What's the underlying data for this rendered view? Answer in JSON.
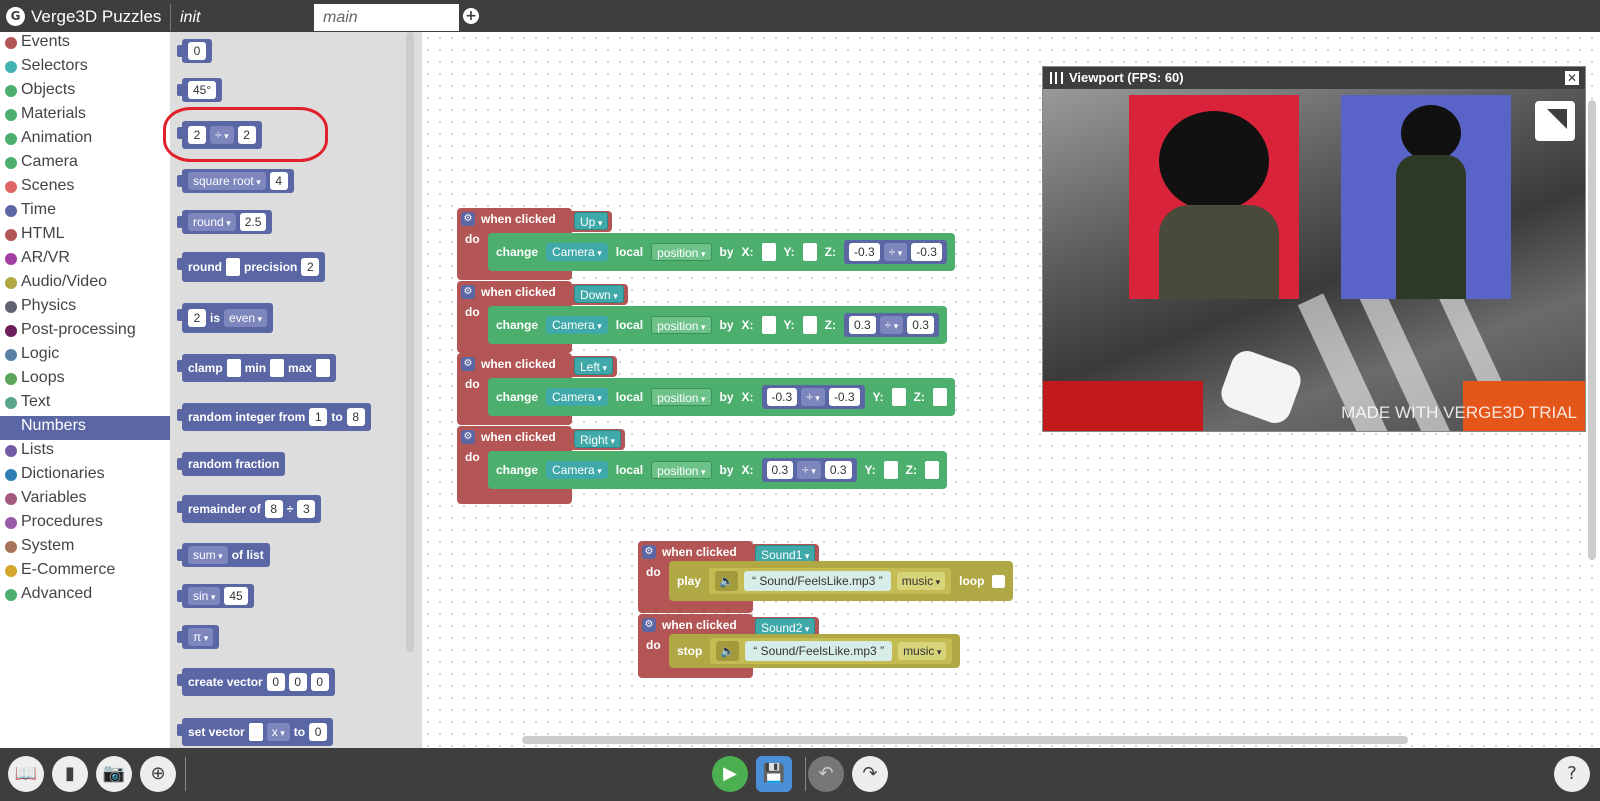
{
  "app": {
    "logo_glyph": "G",
    "title": "Verge3D Puzzles"
  },
  "tabs": {
    "init": "init",
    "main": "main",
    "add_glyph": "+"
  },
  "categories": [
    {
      "label": "Events",
      "color": "#b35555"
    },
    {
      "label": "Selectors",
      "color": "#45b3b3"
    },
    {
      "label": "Objects",
      "color": "#4caf6e"
    },
    {
      "label": "Materials",
      "color": "#4caf6e"
    },
    {
      "label": "Animation",
      "color": "#4caf6e"
    },
    {
      "label": "Camera",
      "color": "#4caf6e"
    },
    {
      "label": "Scenes",
      "color": "#e06666"
    },
    {
      "label": "Time",
      "color": "#5b67a5"
    },
    {
      "label": "HTML",
      "color": "#b35555"
    },
    {
      "label": "AR/VR",
      "color": "#a33fa3"
    },
    {
      "label": "Audio/Video",
      "color": "#b0a845"
    },
    {
      "label": "Physics",
      "color": "#5f6470"
    },
    {
      "label": "Post-processing",
      "color": "#6b1e5b"
    },
    {
      "label": "Logic",
      "color": "#5b80a5"
    },
    {
      "label": "Loops",
      "color": "#5ba55b"
    },
    {
      "label": "Text",
      "color": "#5ba58c"
    },
    {
      "label": "Numbers",
      "color": "#5b67a5"
    },
    {
      "label": "Lists",
      "color": "#745ba5"
    },
    {
      "label": "Dictionaries",
      "color": "#2f7fb5"
    },
    {
      "label": "Variables",
      "color": "#a55b80"
    },
    {
      "label": "Procedures",
      "color": "#995ba5"
    },
    {
      "label": "System",
      "color": "#a5745b"
    },
    {
      "label": "E-Commerce",
      "color": "#d4a72c"
    },
    {
      "label": "Advanced",
      "color": "#4caf6e"
    }
  ],
  "flyout": {
    "num0": "0",
    "angle": "45°",
    "arith": {
      "a": "2",
      "op": "÷",
      "b": "2"
    },
    "sqrt": {
      "fn": "square root",
      "val": "4"
    },
    "round1": {
      "fn": "round",
      "val": "2.5"
    },
    "round2": {
      "label": "round",
      "precision": "precision",
      "val": "2"
    },
    "even": {
      "val": "2",
      "is": "is",
      "prop": "even"
    },
    "clamp": {
      "label": "clamp",
      "min": "min",
      "max": "max"
    },
    "randint": {
      "label": "random integer from",
      "from": "1",
      "to": "to",
      "to_val": "8"
    },
    "randfrac": "random fraction",
    "remainder": {
      "label": "remainder of",
      "a": "8",
      "op": "÷",
      "b": "3"
    },
    "sum": {
      "fn": "sum",
      "label": "of list"
    },
    "sin": {
      "fn": "sin",
      "val": "45"
    },
    "pi": "π",
    "vector": {
      "label": "create vector",
      "x": "0",
      "y": "0",
      "z": "0"
    },
    "setvec": {
      "label": "set vector",
      "axis": "x",
      "to": "to",
      "val": "0"
    }
  },
  "events": [
    {
      "head": "when clicked",
      "target": "Up",
      "do": "do",
      "change": "change",
      "camera": "Camera",
      "local": "local",
      "position": "position",
      "by": "by",
      "x_label": "X:",
      "y_label": "Y:",
      "z_label": "Z:",
      "a": "-0.3",
      "op": "÷",
      "b": "-0.3"
    },
    {
      "head": "when clicked",
      "target": "Down",
      "do": "do",
      "change": "change",
      "camera": "Camera",
      "local": "local",
      "position": "position",
      "by": "by",
      "x_label": "X:",
      "y_label": "Y:",
      "z_label": "Z:",
      "a": "0.3",
      "op": "÷",
      "b": "0.3"
    },
    {
      "head": "when clicked",
      "target": "Left",
      "do": "do",
      "change": "change",
      "camera": "Camera",
      "local": "local",
      "position": "position",
      "by": "by",
      "x_label": "X:",
      "y_label": "Y:",
      "z_label": "Z:",
      "a": "-0.3",
      "op": "÷",
      "b": "-0.3"
    },
    {
      "head": "when clicked",
      "target": "Right",
      "do": "do",
      "change": "change",
      "camera": "Camera",
      "local": "local",
      "position": "position",
      "by": "by",
      "x_label": "X:",
      "y_label": "Y:",
      "z_label": "Z:",
      "a": "0.3",
      "op": "÷",
      "b": "0.3"
    }
  ],
  "sound_events": [
    {
      "head": "when clicked",
      "target": "Sound1",
      "do": "do",
      "action": "play",
      "file": "Sound/FeelsLike.mp3",
      "type": "music",
      "loop": "loop",
      "quote_open": "“",
      "quote_close": "”",
      "speaker": "🔈"
    },
    {
      "head": "when clicked",
      "target": "Sound2",
      "do": "do",
      "action": "stop",
      "file": "Sound/FeelsLike.mp3",
      "type": "music",
      "quote_open": "“",
      "quote_close": "”",
      "speaker": "🔈"
    }
  ],
  "viewport": {
    "title": "Viewport (FPS: 60)",
    "close_glyph": "✕",
    "watermark": "MADE WITH VERGE3D TRIAL"
  },
  "bottom_bar": {
    "library_glyph": "📖",
    "layout_glyph": "▮",
    "screenshot_glyph": "📷",
    "target_glyph": "⊕",
    "play_glyph": "▶",
    "save_glyph": "💾",
    "undo_glyph": "↶",
    "redo_glyph": "↷",
    "help_glyph": "?"
  },
  "colors": {
    "accent": "#5b67a5",
    "event": "#b35555",
    "action": "#4caf6e",
    "audio": "#b0a845"
  }
}
